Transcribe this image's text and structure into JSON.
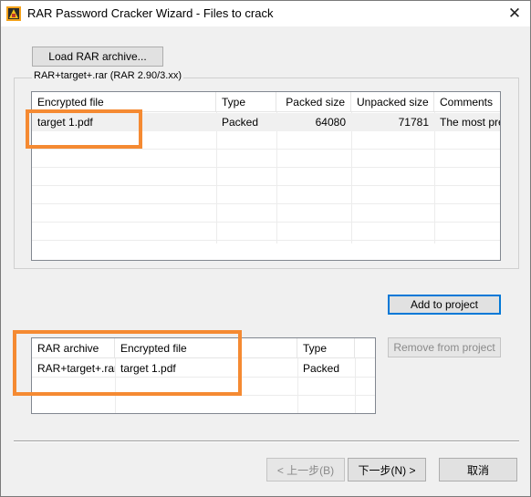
{
  "window": {
    "title": "RAR Password Cracker Wizard - Files to crack",
    "close_glyph": "✕"
  },
  "load_button": "Load RAR archive...",
  "archive_group": {
    "label": "RAR+target+.rar (RAR 2.90/3.xx)",
    "columns": [
      "Encrypted file",
      "Type",
      "Packed size",
      "Unpacked size",
      "Comments"
    ],
    "rows": [
      {
        "file": "target 1.pdf",
        "type": "Packed",
        "packed": "64080",
        "unpacked": "71781",
        "comments": "The most pref"
      }
    ]
  },
  "add_button": "Add to project",
  "remove_button": "Remove from project",
  "project_list": {
    "columns": [
      "RAR archive",
      "Encrypted file",
      "Type"
    ],
    "rows": [
      {
        "archive": "RAR+target+.rar",
        "file": "target 1.pdf",
        "type": "Packed"
      }
    ]
  },
  "nav": {
    "back": "< 上一步(B)",
    "next": "下一步(N) >",
    "cancel": "取消"
  },
  "colors": {
    "highlight": "#f58a32",
    "focus": "#0078d7"
  },
  "icons": {
    "app": "app-logo-icon",
    "scroll_left": "chevron-left-icon",
    "scroll_right": "chevron-right-icon"
  }
}
